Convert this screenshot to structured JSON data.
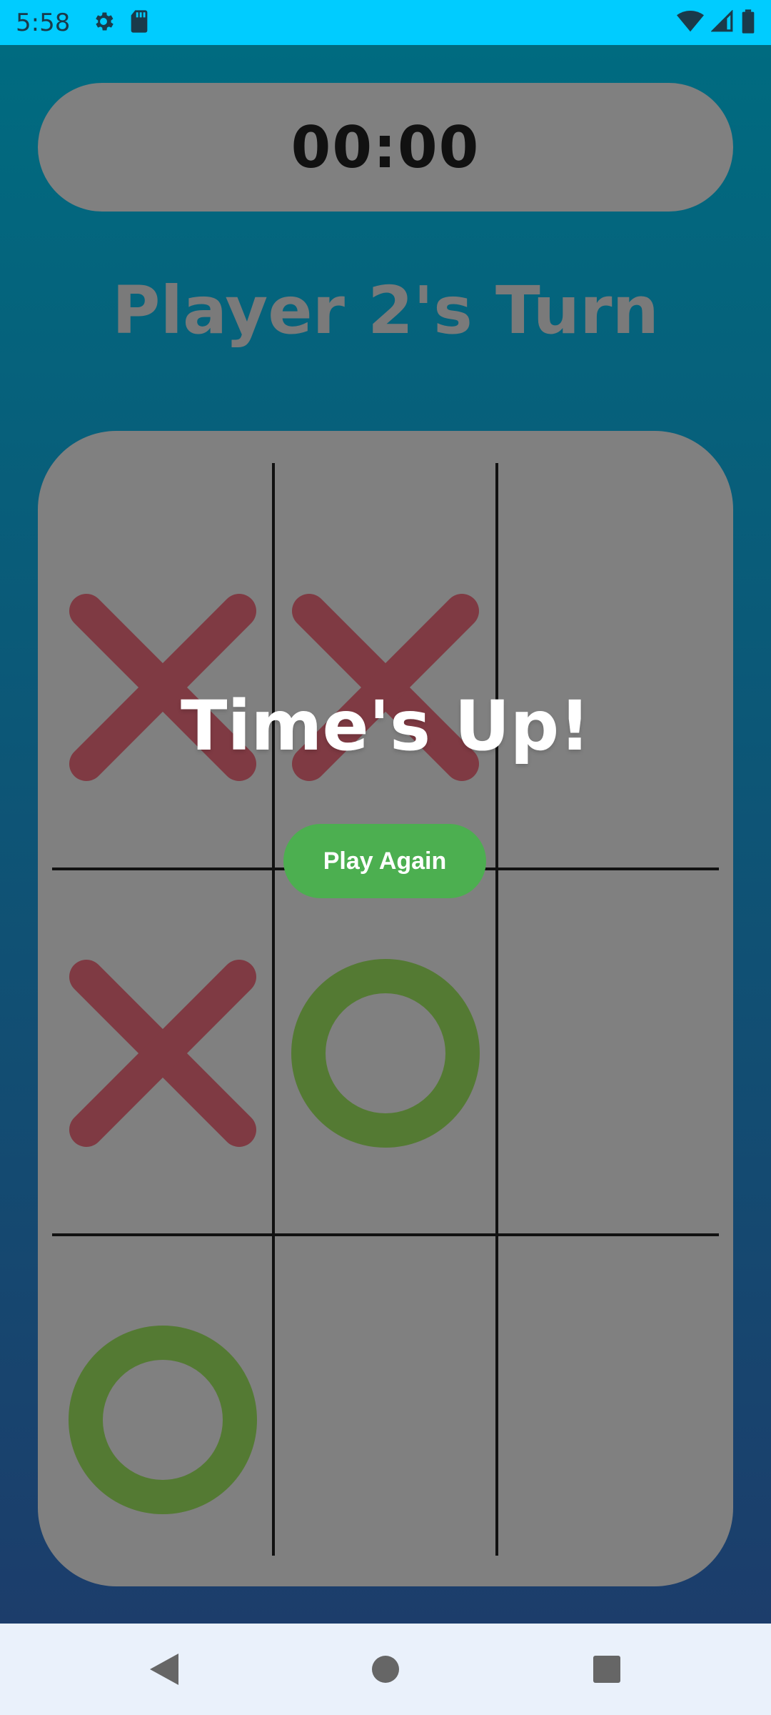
{
  "status_bar": {
    "time": "5:58",
    "left_icons": [
      "gear-icon",
      "sd-card-icon"
    ],
    "right_icons": [
      "wifi-icon",
      "signal-icon",
      "battery-icon"
    ],
    "background": "#00ccff"
  },
  "game": {
    "timer": "00:00",
    "turn_label": "Player 2's Turn",
    "overlay_title": "Time's Up!",
    "play_again_label": "Play Again",
    "board": [
      [
        "X",
        "X",
        ""
      ],
      [
        "X",
        "O",
        ""
      ],
      [
        "O",
        "",
        ""
      ]
    ]
  },
  "colors": {
    "background_top": "#006b80",
    "background_bottom": "#1c3d6b",
    "card": "#808080",
    "x_mark": "#7f3a43",
    "o_mark": "#547a33",
    "grid_line": "#111111",
    "button": "#4caf50",
    "nav_bar": "#eaf1fb",
    "nav_icon": "#666666"
  },
  "nav_bar": {
    "icons": [
      "back-icon",
      "home-icon",
      "recents-icon"
    ]
  }
}
